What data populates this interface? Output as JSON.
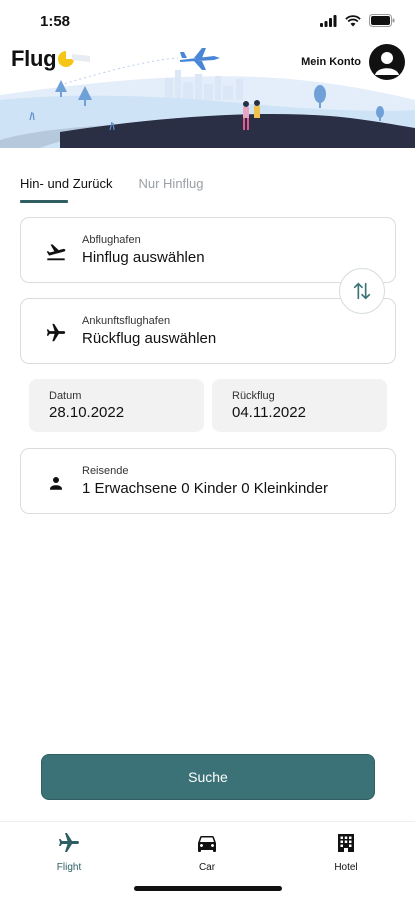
{
  "status_bar": {
    "time": "1:58"
  },
  "header": {
    "logo_text": "Flug",
    "account_label": "Mein Konto"
  },
  "tabs": [
    {
      "label": "Hin- und Zurück",
      "active": true
    },
    {
      "label": "Nur Hinflug",
      "active": false
    }
  ],
  "departure": {
    "label": "Abflughafen",
    "value": "Hinflug auswählen",
    "icon": "plane-takeoff-icon"
  },
  "arrival": {
    "label": "Ankunftsflughafen",
    "value": "Rückflug auswählen",
    "icon": "plane-icon"
  },
  "dates": {
    "outbound": {
      "label": "Datum",
      "value": "28.10.2022"
    },
    "return": {
      "label": "Rückflug",
      "value": "04.11.2022"
    }
  },
  "travelers": {
    "label": "Reisende",
    "value": "1 Erwachsene 0 Kinder 0 Kleinkinder",
    "icon": "person-icon"
  },
  "search_button": {
    "label": "Suche"
  },
  "bottom_nav": [
    {
      "label": "Flight",
      "icon": "plane-icon",
      "active": true
    },
    {
      "label": "Car",
      "icon": "car-icon",
      "active": false
    },
    {
      "label": "Hotel",
      "icon": "building-icon",
      "active": false
    }
  ],
  "colors": {
    "accent": "#2f5f63",
    "button": "#3a7277",
    "logo_yellow": "#f5c518",
    "hero_blue": "#cfe3f7",
    "hill_dark": "#2b2f45"
  }
}
